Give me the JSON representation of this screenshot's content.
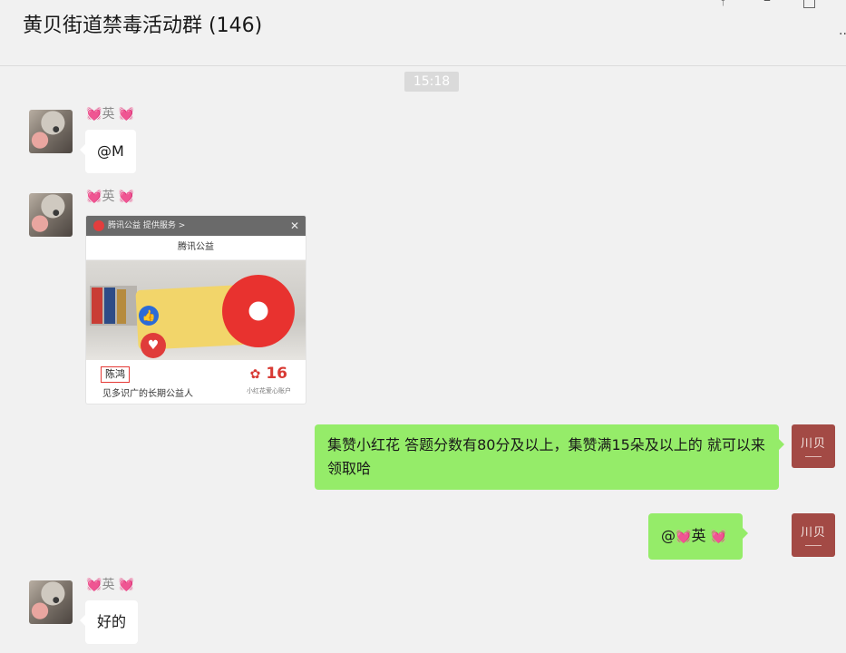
{
  "window": {
    "title": "黄贝街道禁毒活动群 (146)",
    "controls": {
      "pin": "pin-icon",
      "minimize": "minimize-icon",
      "maximize": "maximize-icon",
      "more": "more-icon"
    }
  },
  "timestamp": "15:18",
  "messages": [
    {
      "side": "in",
      "sender_name": "英",
      "text": "@M"
    },
    {
      "side": "in",
      "sender_name": "英",
      "type": "image",
      "card": {
        "header": "腾讯公益 提供服务 >",
        "title": "腾讯公益",
        "name_box": "陈鸿",
        "desc": "见多识广的长期公益人",
        "count": "16",
        "count_sub": "小红花爱心账户"
      }
    },
    {
      "side": "out",
      "text": "集赞小红花  答题分数有80分及以上，集赞满15朵及以上的  就可以来领取哈",
      "avatar_text": "川贝"
    },
    {
      "side": "out",
      "mention_prefix": "@",
      "mention_name": "英",
      "avatar_text": "川贝"
    },
    {
      "side": "in",
      "sender_name": "英",
      "text": "好的"
    }
  ],
  "emoji": {
    "heart": "💓"
  }
}
